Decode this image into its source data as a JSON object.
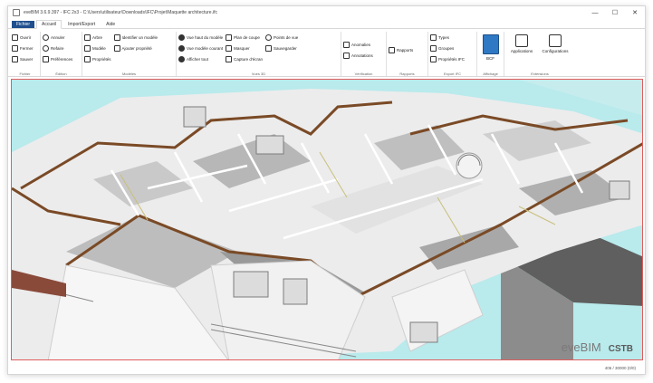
{
  "window": {
    "title": "eveBIM 3.6.9.397 - IFC 2x3 - C:\\Users\\utilisateur\\Downloads\\IFC\\Projet\\Maquette architecture.ifc",
    "minimize": "—",
    "maximize": "☐",
    "close": "✕"
  },
  "menu": {
    "tabs": [
      "Fichier",
      "Accueil",
      "Import/Export",
      "Aide"
    ]
  },
  "ribbon": {
    "groups": [
      {
        "label": "Fichier",
        "buttons": [
          "Ouvrir",
          "Fermer",
          "Sauver"
        ]
      },
      {
        "label": "Édition",
        "buttons": [
          "Annuler",
          "Refaire",
          "Préférences"
        ]
      },
      {
        "label": "Modèles",
        "buttons": [
          "Arbre",
          "Modèle",
          "Propriétés",
          "Identifier un modèle",
          "Ajouter propriété"
        ]
      },
      {
        "label": "Vues 3D",
        "buttons": [
          "Vue haut du modèle",
          "Vue modèle courant",
          "Afficher tout",
          "Plan de coupe",
          "Masquer",
          "Capture d'écran",
          "Points de vue",
          "Sauvegarder"
        ]
      },
      {
        "label": "Vérification",
        "buttons": [
          "Anomalies",
          "Annotations"
        ]
      },
      {
        "label": "Rapports",
        "buttons": [
          "Rapports"
        ]
      },
      {
        "label": "Export IFC",
        "buttons": [
          "Types",
          "Groupes",
          "Propriétés IFC"
        ]
      },
      {
        "label": "Affichage",
        "buttons": [
          "BCF"
        ]
      },
      {
        "label": "Extensions",
        "buttons": [
          "Applications",
          "Configurations"
        ]
      }
    ]
  },
  "viewport": {
    "brand_name": "eveBIM",
    "brand_org": "CSTB"
  },
  "status": {
    "text": "406 / 30000 (0/0)"
  }
}
